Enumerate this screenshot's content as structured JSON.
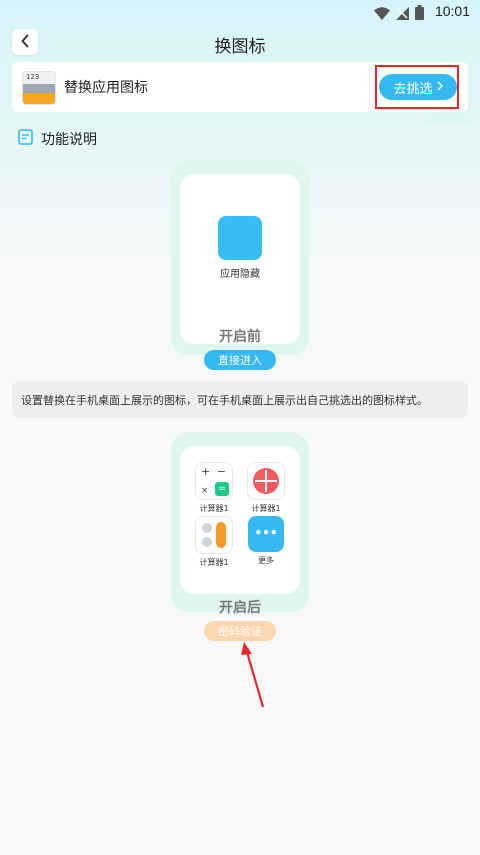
{
  "status_bar": {
    "time": "10:01"
  },
  "header": {
    "title": "换图标"
  },
  "replace_card": {
    "label": "替换应用图标",
    "icon_digits": "123",
    "select_label": "去挑选"
  },
  "section": {
    "title": "功能说明"
  },
  "before": {
    "app_label": "应用隐藏",
    "state_label": "开启前",
    "pill_label": "直接进入"
  },
  "description": "设置替换在手机桌面上展示的图标，可在手机桌面上展示出自己挑选出的图标样式。",
  "after": {
    "apps": [
      {
        "label": "计算器1"
      },
      {
        "label": "计算器1"
      },
      {
        "label": "计算器1"
      },
      {
        "label": "更多"
      }
    ],
    "state_label": "开启后",
    "pill_label": "密码验证"
  },
  "colors": {
    "accent": "#36b9f2",
    "highlight": "#e8262a",
    "pill_blue": "#36b9f2",
    "pill_orange": "#fbd4b0",
    "mint": "#dff6ee"
  },
  "icons": [
    "wifi-icon",
    "signal-icon",
    "battery-icon",
    "back-icon",
    "chevron-right-icon",
    "document-icon",
    "arrow-annotation"
  ]
}
